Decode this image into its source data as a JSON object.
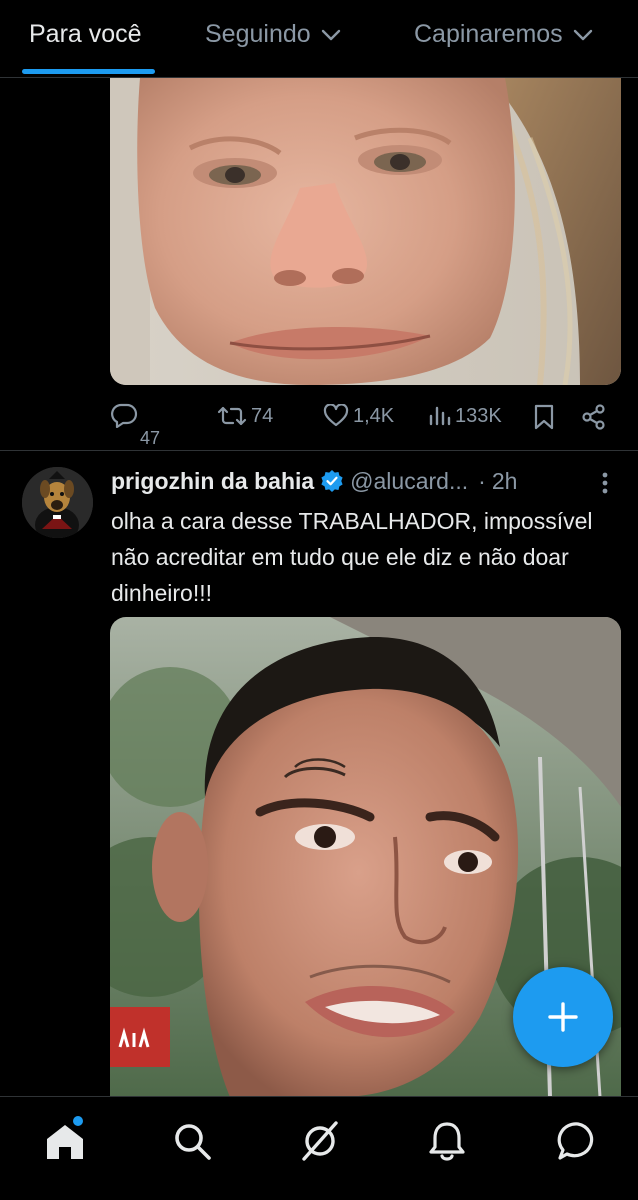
{
  "tabs": [
    {
      "label": "Para você",
      "active": true
    },
    {
      "label": "Seguindo",
      "has_dropdown": true
    },
    {
      "label": "Capinaremos",
      "has_dropdown": true
    }
  ],
  "tweet1": {
    "image_alt": "close-up photo of a person's face",
    "actions": {
      "reply": {
        "icon": "reply-icon",
        "count": "47"
      },
      "retweet": {
        "icon": "retweet-icon",
        "count": "74"
      },
      "like": {
        "icon": "heart-icon",
        "count": "1,4K"
      },
      "views": {
        "icon": "views-icon",
        "count": "133K"
      },
      "bookmark": {
        "icon": "bookmark-icon"
      },
      "share": {
        "icon": "share-icon"
      }
    }
  },
  "tweet2": {
    "author_name": "prigozhin da bahia",
    "verified": true,
    "handle": "@alucard...",
    "separator": "·",
    "time": "2h",
    "text": "olha a cara desse TRABALHADOR, impossível não acreditar em tudo que ele diz e não doar dinheiro!!!",
    "image_alt": "selfie photo of a man with a forehead tattoo"
  },
  "fab": {
    "icon": "plus-icon"
  },
  "bottom_nav": [
    {
      "icon": "home-icon",
      "active": true,
      "notification_dot": true
    },
    {
      "icon": "search-icon"
    },
    {
      "icon": "grok-icon"
    },
    {
      "icon": "bell-icon"
    },
    {
      "icon": "messages-icon"
    }
  ],
  "colors": {
    "background": "#000000",
    "accent": "#1d9bf0",
    "text_primary": "#e7e9ea",
    "text_secondary": "#8b98a5",
    "divider": "#2f3336"
  }
}
